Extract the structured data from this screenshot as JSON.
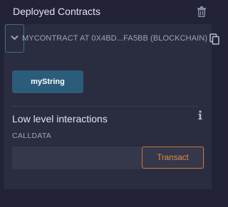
{
  "section": {
    "title": "Deployed Contracts",
    "trash_icon": "trash-icon"
  },
  "contract": {
    "expand_icon": "chevron-down-icon",
    "name": "MYCONTRACT AT 0X4BD...FA5BB (BLOCKCHAIN)",
    "copy_icon": "copy-icon",
    "functions": [
      {
        "label": "myString"
      }
    ],
    "low_level": {
      "title": "Low level interactions",
      "info_icon": "info-icon",
      "calldata_label": "CALLDATA",
      "calldata_value": "",
      "calldata_placeholder": "",
      "transact_label": "Transact"
    }
  },
  "colors": {
    "background": "#222336",
    "panel": "#2a2c3f",
    "function_button": "#2b5c79",
    "transact_border": "#c97539",
    "text_primary": "#e3e4ee",
    "text_secondary": "#9fa3bb"
  }
}
